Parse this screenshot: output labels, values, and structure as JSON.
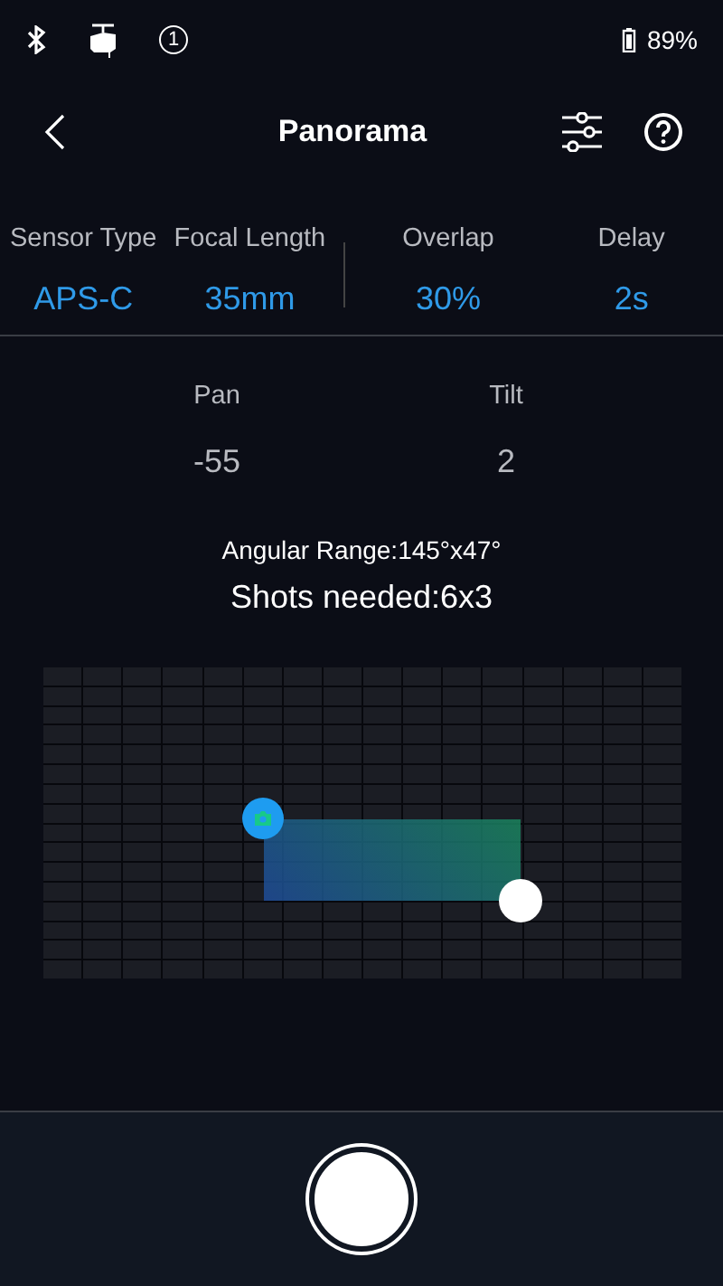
{
  "status_bar": {
    "badge": "1",
    "battery": "89%"
  },
  "header": {
    "title": "Panorama"
  },
  "settings": [
    {
      "label": "Sensor Type",
      "value": "APS-C"
    },
    {
      "label": "Focal Length",
      "value": "35mm"
    },
    {
      "label": "Overlap",
      "value": "30%"
    },
    {
      "label": "Delay",
      "value": "2s"
    }
  ],
  "position": [
    {
      "label": "Pan",
      "value": "-55"
    },
    {
      "label": "Tilt",
      "value": "2"
    }
  ],
  "angular_range": "Angular Range:145°x47°",
  "shots_needed": "Shots needed:6x3"
}
